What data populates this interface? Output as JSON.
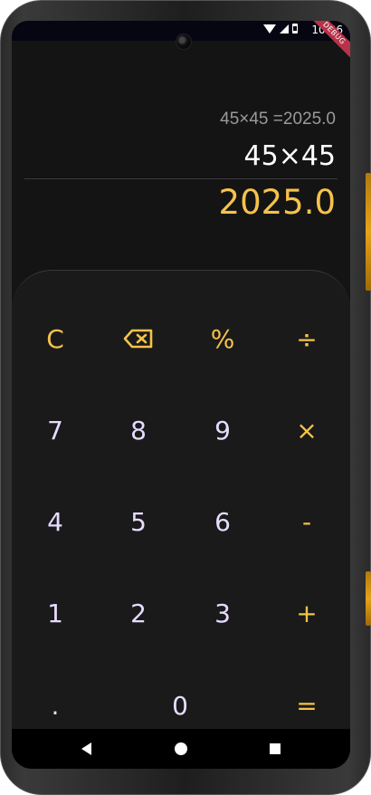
{
  "status": {
    "time": "10:06",
    "debug": "DEBUG"
  },
  "display": {
    "history": "45×45 =2025.0",
    "expression": "45×45",
    "result": "2025.0"
  },
  "keys": {
    "clear": "C",
    "backspace_icon": "backspace-icon",
    "percent": "%",
    "divide": "÷",
    "seven": "7",
    "eight": "8",
    "nine": "9",
    "multiply": "×",
    "four": "4",
    "five": "5",
    "six": "6",
    "minus": "-",
    "one": "1",
    "two": "2",
    "three": "3",
    "plus": "+",
    "dot": ".",
    "zero": "0",
    "equals": "="
  },
  "colors": {
    "accent": "#f5c24b",
    "digit": "#e7dcff",
    "background": "#141414",
    "keypad": "#1a1a1a"
  }
}
